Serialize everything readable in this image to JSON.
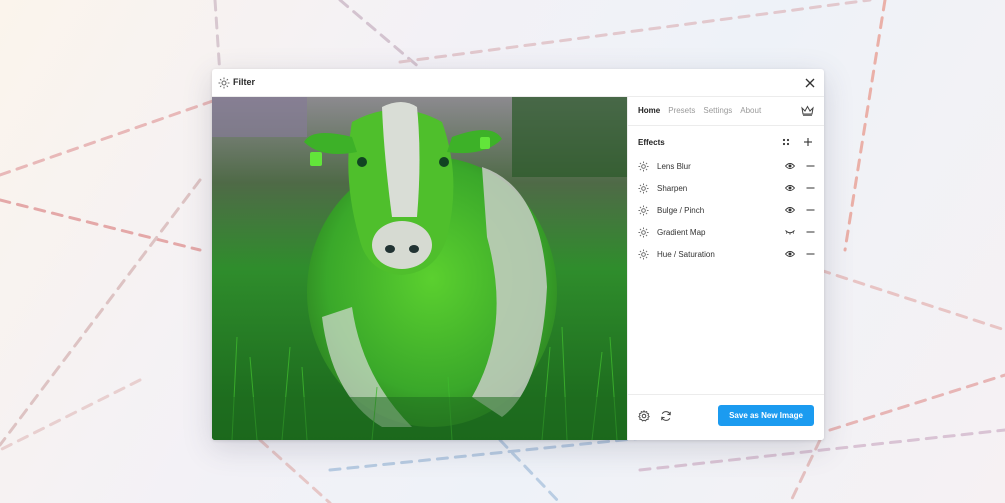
{
  "window": {
    "title": "Filter",
    "title_icon": "sun-icon",
    "close_icon": "close-icon"
  },
  "image": {
    "subject": "cow in grass with green hue filter"
  },
  "panel": {
    "tabs": [
      {
        "label": "Home",
        "active": true
      },
      {
        "label": "Presets",
        "active": false
      },
      {
        "label": "Settings",
        "active": false
      },
      {
        "label": "About",
        "active": false
      }
    ],
    "premium_icon": "crown-icon",
    "effects_title": "Effects",
    "effects": [
      {
        "label": "Lens Blur",
        "visible": true
      },
      {
        "label": "Sharpen",
        "visible": true
      },
      {
        "label": "Bulge / Pinch",
        "visible": true
      },
      {
        "label": "Gradient Map",
        "visible": false
      },
      {
        "label": "Hue / Saturation",
        "visible": true
      }
    ],
    "save_label": "Save as New Image"
  },
  "colors": {
    "accent": "#1b9bf0",
    "tint": "#4fc22a"
  }
}
